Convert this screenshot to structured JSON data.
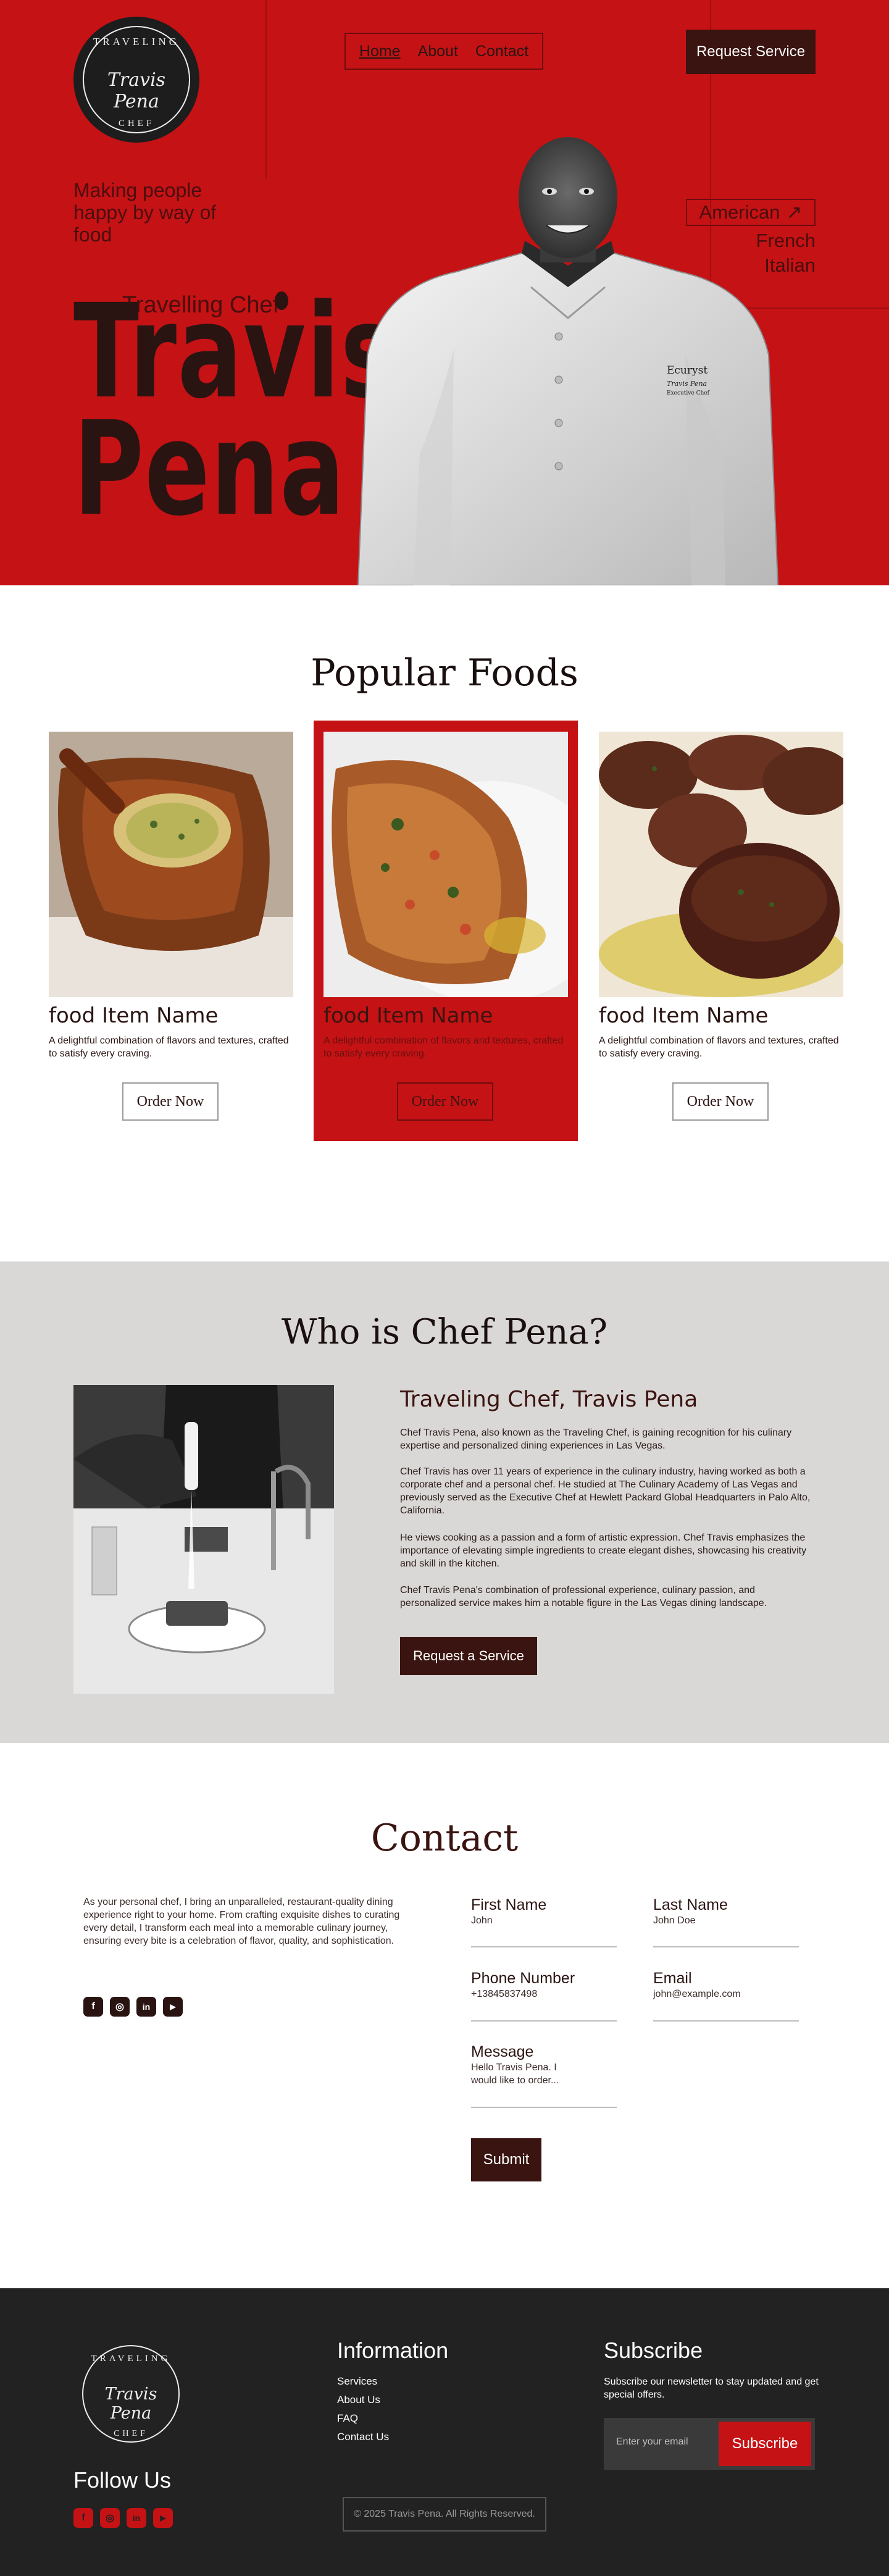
{
  "colors": {
    "hero_red": "#c51215",
    "dark_brown": "#3a1410",
    "gray_bg": "#dad8d6",
    "footer_bg": "#222222",
    "accent_red": "#c51215"
  },
  "logo": {
    "top": "TRAVELING",
    "script": "Travis Pena",
    "bottom": "CHEF"
  },
  "nav": {
    "items": [
      "Home",
      "About",
      "Contact"
    ],
    "request_label": "Request Service"
  },
  "hero": {
    "tagline": "Making people happy by way of food",
    "subtitle": "Travelling Chef",
    "first_name": "Travis",
    "last_name": "Pena",
    "cuisines": [
      "American",
      "French",
      "Italian"
    ],
    "jacket_brand": "Ecuryst",
    "jacket_name": "Travis Pena",
    "jacket_role": "Executive Chef"
  },
  "popular": {
    "title": "Popular Foods",
    "items": [
      {
        "name": "food Item Name",
        "description": "A delightful combination of flavors and textures, crafted to satisfy every craving.",
        "button": "Order Now"
      },
      {
        "name": "food Item Name",
        "description": "A delightful combination of flavors and textures, crafted to satisfy every craving.",
        "button": "Order Now"
      },
      {
        "name": "food Item Name",
        "description": "A delightful combination of flavors and textures, crafted to satisfy every craving.",
        "button": "Order Now"
      }
    ]
  },
  "about": {
    "title": "Who is Chef Pena?",
    "heading": "Traveling Chef, Travis Pena",
    "paragraphs": [
      "Chef Travis Pena, also known as the Traveling Chef, is gaining recognition for his culinary expertise and personalized dining experiences in Las Vegas.",
      "Chef Travis has over 11 years of experience in the culinary industry, having worked as both a corporate chef and a personal chef. He studied at The Culinary Academy of Las Vegas and previously served as the Executive Chef at Hewlett Packard Global Headquarters in Palo Alto, California.",
      "He views cooking as a passion and a form of artistic expression. Chef Travis emphasizes the importance of elevating simple ingredients to create elegant dishes, showcasing his creativity and skill in the kitchen.",
      "Chef Travis Pena's combination of professional experience, culinary passion, and personalized service makes him a notable figure in the Las Vegas dining landscape."
    ],
    "button": "Request a Service"
  },
  "contact": {
    "title": "Contact",
    "intro": "As your personal chef, I bring an unparalleled, restaurant-quality dining experience right to your home. From crafting exquisite dishes to curating every detail, I transform each meal into a memorable culinary journey, ensuring every bite is a celebration of flavor, quality, and sophistication.",
    "social": [
      "facebook-icon",
      "instagram-icon",
      "linkedin-icon",
      "youtube-icon"
    ],
    "fields": {
      "first_name_label": "First Name",
      "first_name_placeholder": "John",
      "last_name_label": "Last Name",
      "last_name_placeholder": "John Doe",
      "phone_label": "Phone Number",
      "phone_placeholder": "+13845837498",
      "email_label": "Email",
      "email_placeholder": "john@example.com",
      "message_label": "Message",
      "message_placeholder": "Hello Travis Pena. I would like to order..."
    },
    "submit": "Submit"
  },
  "footer": {
    "follow": "Follow Us",
    "info_title": "Information",
    "links": [
      "Services",
      "About Us",
      "FAQ",
      "Contact Us"
    ],
    "subscribe_title": "Subscribe",
    "subscribe_text": "Subscribe our newsletter to stay updated and get special offers.",
    "email_placeholder": "Enter your email",
    "subscribe_button": "Subscribe",
    "copyright": "© 2025 Travis Pena. All Rights Reserved."
  }
}
